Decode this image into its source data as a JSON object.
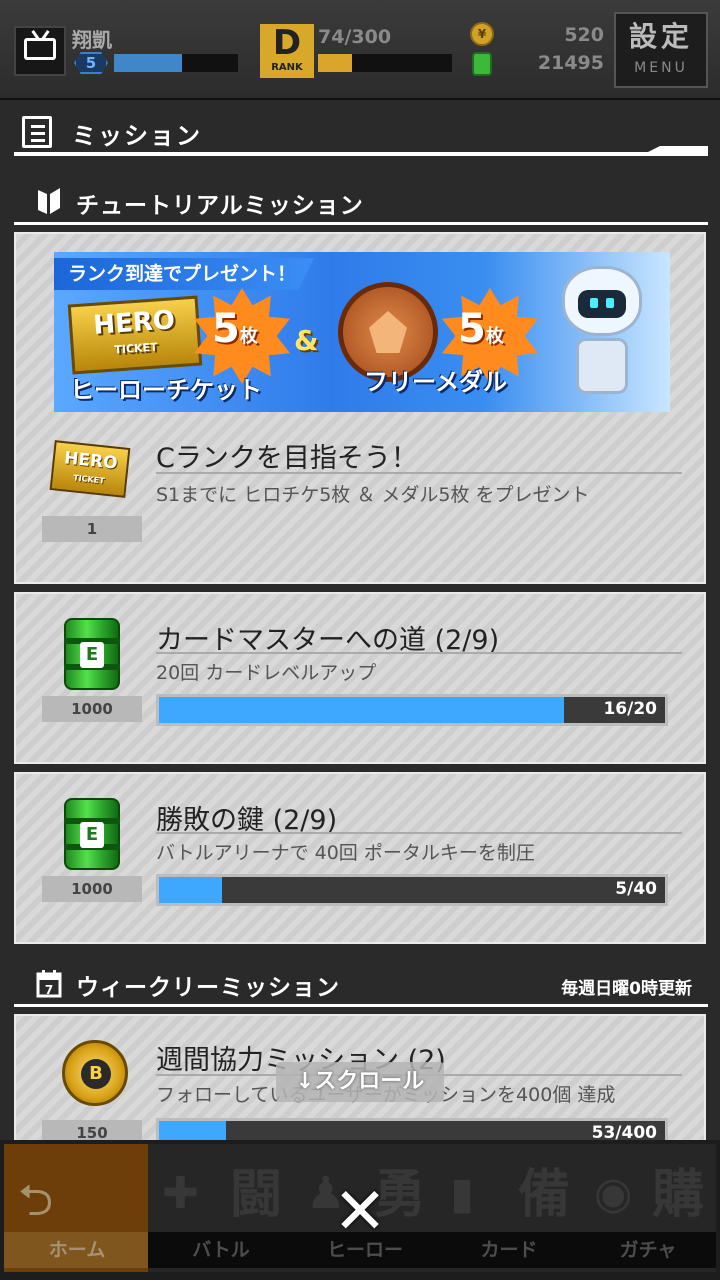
{
  "status": {
    "player_name": "翔凱",
    "player_level": "5",
    "player_level_progress": 0.55,
    "rank_label": "RANK",
    "rank_letter": "D",
    "rank_progress_text": "74/300",
    "rank_progress": 0.25,
    "coins": "520",
    "energy": "21495",
    "settings_label": "設定",
    "settings_sub": "MENU"
  },
  "screen": {
    "title": "ミッション"
  },
  "tutorial": {
    "header": "チュートリアルミッション",
    "banner": {
      "tagline": "ランク到達でプレゼント！",
      "ticket_logo": "HERO",
      "ticket_logo_sub": "TICKET",
      "count1": "5",
      "count2": "5",
      "unit": "枚",
      "amp": "&",
      "caption1": "ヒーローチケット",
      "caption2": "フリーメダル"
    },
    "missions": [
      {
        "reward_icon": "hero-ticket-icon",
        "reward_logo": "HERO",
        "reward_logo_sub": "TICKET",
        "reward_count": "1",
        "title": "Cランクを目指そう！",
        "desc": "S1までに ヒロチケ5枚 ＆ メダル5枚 をプレゼント"
      },
      {
        "reward_icon": "green-energy-can-icon",
        "reward_glyph": "E",
        "reward_count": "1000",
        "title": "カードマスターへの道 (2/9)",
        "desc": "20回 カードレベルアップ",
        "progress_text": "16/20",
        "progress": 0.8
      },
      {
        "reward_icon": "green-energy-can-icon",
        "reward_glyph": "E",
        "reward_count": "1000",
        "title": "勝敗の鍵 (2/9)",
        "desc": "バトルアリーナで 40回 ポータルキーを制圧",
        "progress_text": "5/40",
        "progress": 0.125
      }
    ]
  },
  "weekly": {
    "header": "ウィークリーミッション",
    "calendar_day": "7",
    "update_note": "毎週日曜0時更新",
    "missions": [
      {
        "reward_icon": "gold-coin-icon",
        "reward_glyph": "B",
        "reward_count": "150",
        "title": "週間協力ミッション (2)",
        "desc": "フォローしているユーザーがミッションを400個 達成",
        "progress_text": "53/400",
        "progress": 0.1325
      }
    ]
  },
  "scroll_hint": "↓スクロール",
  "nav": [
    {
      "label": "ホーム",
      "kanji": "",
      "glyph": "⮌"
    },
    {
      "label": "バトル",
      "kanji": "闘",
      "glyph": "✚"
    },
    {
      "label": "ヒーロー",
      "kanji": "勇",
      "glyph": "♟"
    },
    {
      "label": "カード",
      "kanji": "備",
      "glyph": "▮"
    },
    {
      "label": "ガチャ",
      "kanji": "購",
      "glyph": "◉"
    }
  ],
  "close_glyph": "✕",
  "colors": {
    "progress": "#3ea8ff",
    "accent_orange": "#c4852e",
    "rank_gold": "#d9a52a"
  }
}
